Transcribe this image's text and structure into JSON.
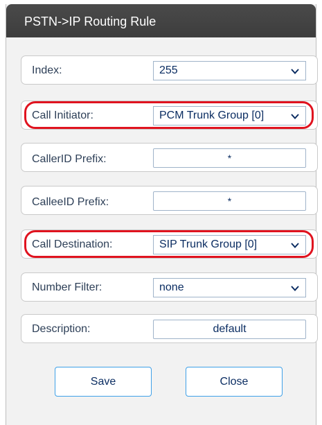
{
  "dialog": {
    "title": "PSTN->IP Routing Rule"
  },
  "form": {
    "index": {
      "label": "Index:",
      "value": "255"
    },
    "call_initiator": {
      "label": "Call Initiator:",
      "value": "PCM Trunk Group [0]"
    },
    "callerid_prefix": {
      "label": "CallerID Prefix:",
      "value": "*"
    },
    "calleeid_prefix": {
      "label": "CalleeID Prefix:",
      "value": "*"
    },
    "call_destination": {
      "label": "Call Destination:",
      "value": "SIP Trunk Group [0]"
    },
    "number_filter": {
      "label": "Number Filter:",
      "value": "none"
    },
    "description": {
      "label": "Description:",
      "value": "default"
    }
  },
  "buttons": {
    "save": "Save",
    "close": "Close"
  },
  "icons": {
    "dropdown": "chevron-down-icon"
  },
  "colors": {
    "titlebar": "#3f3f3f",
    "panel": "#f2f2f2",
    "label_text": "#2d3f57",
    "value_text": "#0b2d62",
    "highlight": "#e0131f",
    "button_border": "#3ea0e8"
  }
}
